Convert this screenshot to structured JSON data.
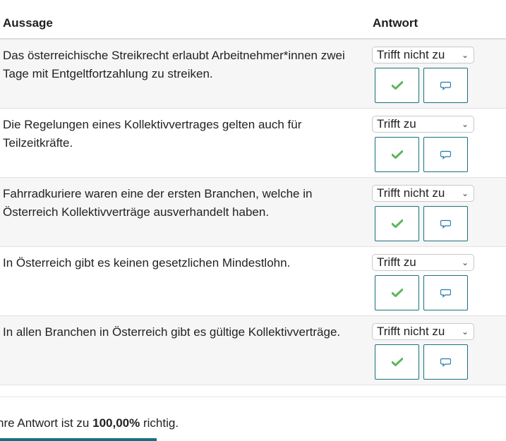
{
  "table": {
    "col_statement": "Aussage",
    "col_answer": "Antwort",
    "rows": [
      {
        "statement": "Das österreichische Streikrecht erlaubt Arbeitnehmer*innen zwei Tage mit Entgeltfortzahlung zu streiken.",
        "answer": "Trifft nicht zu"
      },
      {
        "statement": "Die Regelungen eines Kollektivvertrages gelten auch für Teilzeitkräfte.",
        "answer": "Trifft zu"
      },
      {
        "statement": "Fahrradkuriere waren eine der ersten Branchen, welche in Österreich Kollektivverträge ausverhandelt haben.",
        "answer": "Trifft nicht zu"
      },
      {
        "statement": "In Österreich gibt es keinen gesetzlichen Mindestlohn.",
        "answer": "Trifft zu"
      },
      {
        "statement": "In allen Branchen in Österreich gibt es gültige Kollektivverträge.",
        "answer": "Trifft nicht zu"
      }
    ]
  },
  "icons": {
    "correct": "check-icon",
    "feedback": "comment-icon",
    "dropdown": "chevron-down-icon"
  },
  "colors": {
    "accent": "#17707f",
    "check": "#5cb85c",
    "comment": "#2a78a8",
    "row_alt": "#f6f6f6"
  },
  "result": {
    "prefix": "hre Antwort ist zu ",
    "percent": "100,00%",
    "suffix": " richtig.",
    "progress_fraction": 1.0
  }
}
